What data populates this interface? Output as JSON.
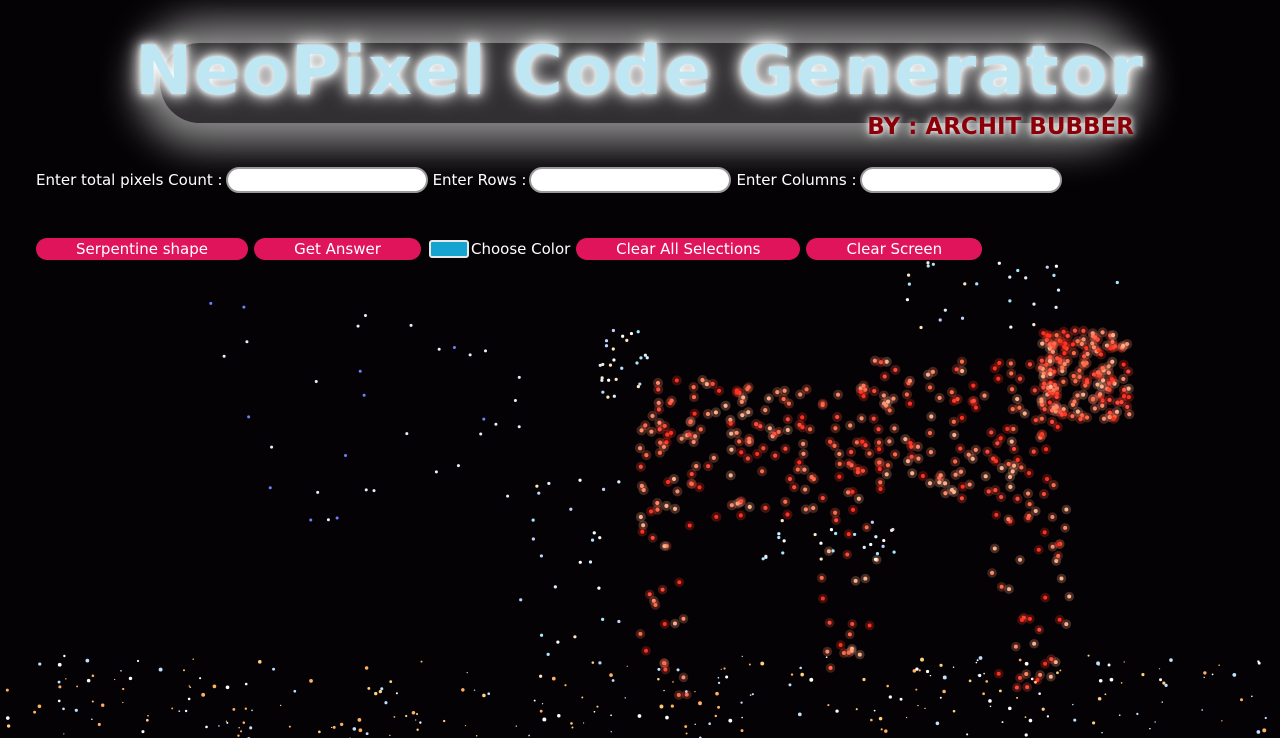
{
  "header": {
    "title": "NeoPixel Code Generator",
    "author": "BY : ARCHIT BUBBER"
  },
  "inputs": {
    "total_label": "Enter total pixels Count :",
    "total_value": "",
    "rows_label": "Enter Rows :",
    "rows_value": "",
    "columns_label": "Enter Columns :",
    "columns_value": ""
  },
  "buttons": {
    "serpentine": "Serpentine shape",
    "get_answer": "Get Answer",
    "choose_color": "Choose Color",
    "clear_selections": "Clear All Selections",
    "clear_screen": "Clear Screen"
  },
  "colors": {
    "button_bg": "#e0145b",
    "picker_value": "#15a3cf",
    "title_text": "#bfe6f3",
    "author_text": "#8b0008"
  },
  "background": {
    "description_icon": "drone-light-show-deer-icon"
  }
}
